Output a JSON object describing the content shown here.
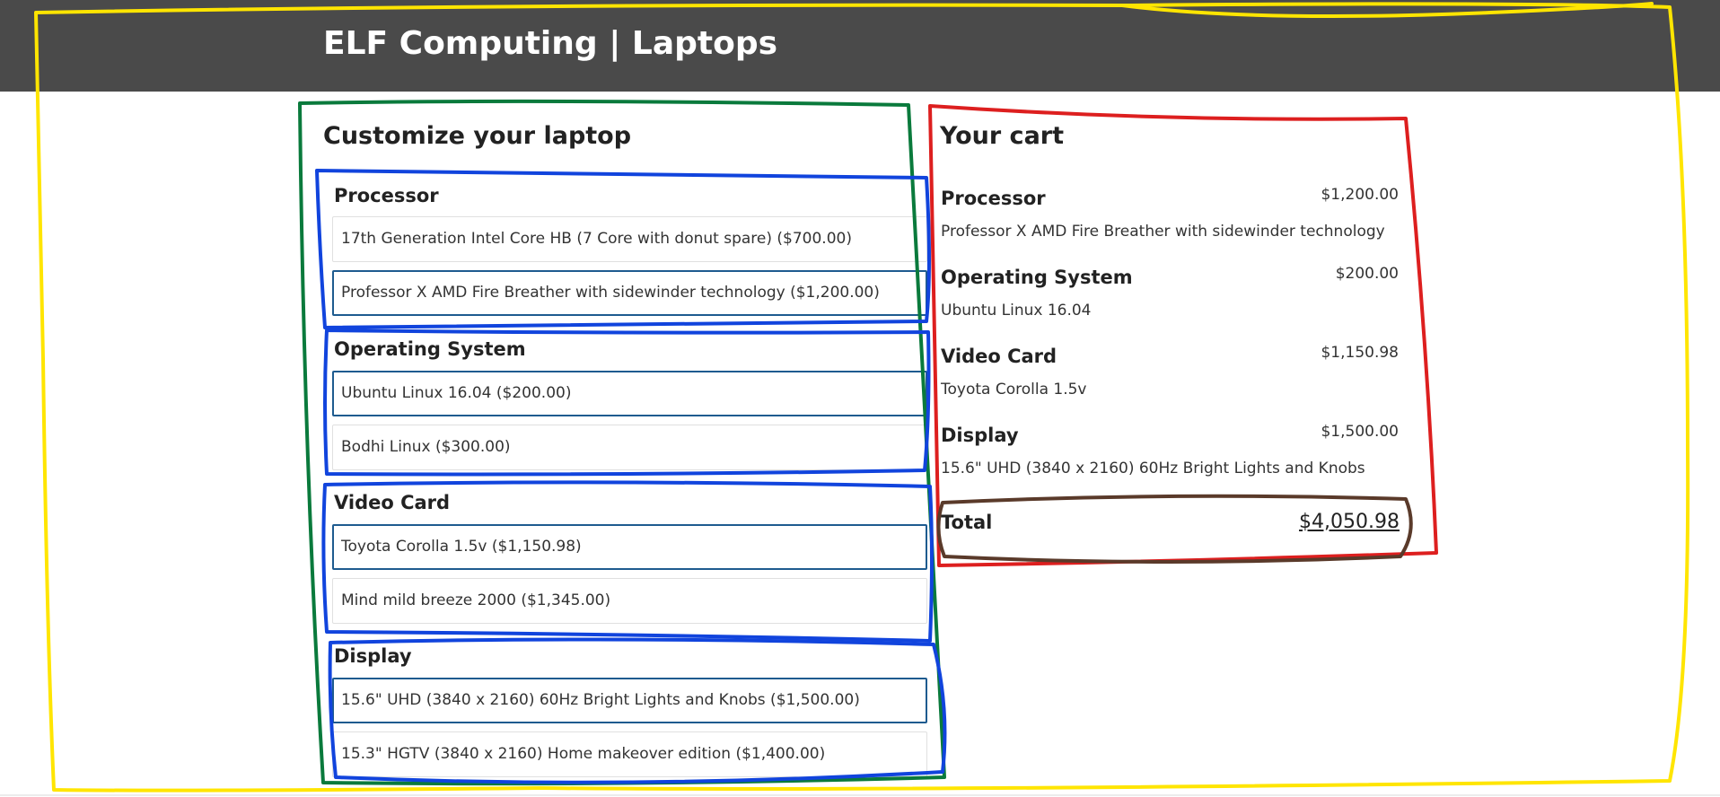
{
  "header": {
    "title": "ELF Computing | Laptops"
  },
  "customize": {
    "title": "Customize your laptop",
    "groups": [
      {
        "label": "Processor",
        "options": [
          {
            "text": "17th Generation Intel Core HB (7 Core with donut spare) ($700.00)",
            "selected": false
          },
          {
            "text": "Professor X AMD Fire Breather with sidewinder technology ($1,200.00)",
            "selected": true
          }
        ]
      },
      {
        "label": "Operating System",
        "options": [
          {
            "text": "Ubuntu Linux 16.04 ($200.00)",
            "selected": true
          },
          {
            "text": "Bodhi Linux ($300.00)",
            "selected": false
          }
        ]
      },
      {
        "label": "Video Card",
        "options": [
          {
            "text": "Toyota Corolla 1.5v ($1,150.98)",
            "selected": true
          },
          {
            "text": "Mind mild breeze 2000 ($1,345.00)",
            "selected": false
          }
        ]
      },
      {
        "label": "Display",
        "options": [
          {
            "text": "15.6\" UHD (3840 x 2160) 60Hz Bright Lights and Knobs ($1,500.00)",
            "selected": true
          },
          {
            "text": "15.3\" HGTV (3840 x 2160) Home makeover edition ($1,400.00)",
            "selected": false
          }
        ]
      }
    ]
  },
  "cart": {
    "title": "Your cart",
    "items": [
      {
        "name": "Processor",
        "price": "$1,200.00",
        "desc": "Professor X AMD Fire Breather with sidewinder technology"
      },
      {
        "name": "Operating System",
        "price": "$200.00",
        "desc": "Ubuntu Linux 16.04"
      },
      {
        "name": "Video Card",
        "price": "$1,150.98",
        "desc": "Toyota Corolla 1.5v"
      },
      {
        "name": "Display",
        "price": "$1,500.00",
        "desc": "15.6\" UHD (3840 x 2160) 60Hz Bright Lights and Knobs"
      }
    ],
    "total_label": "Total",
    "total_value": "$4,050.98"
  },
  "colors": {
    "header_bg": "#4a4a4a",
    "selected_border": "#1e5b8f",
    "annot_yellow": "#ffe500",
    "annot_green": "#0a7a3c",
    "annot_blue": "#1144dd",
    "annot_red": "#dd1f1f",
    "annot_brown": "#5a3a2a"
  }
}
